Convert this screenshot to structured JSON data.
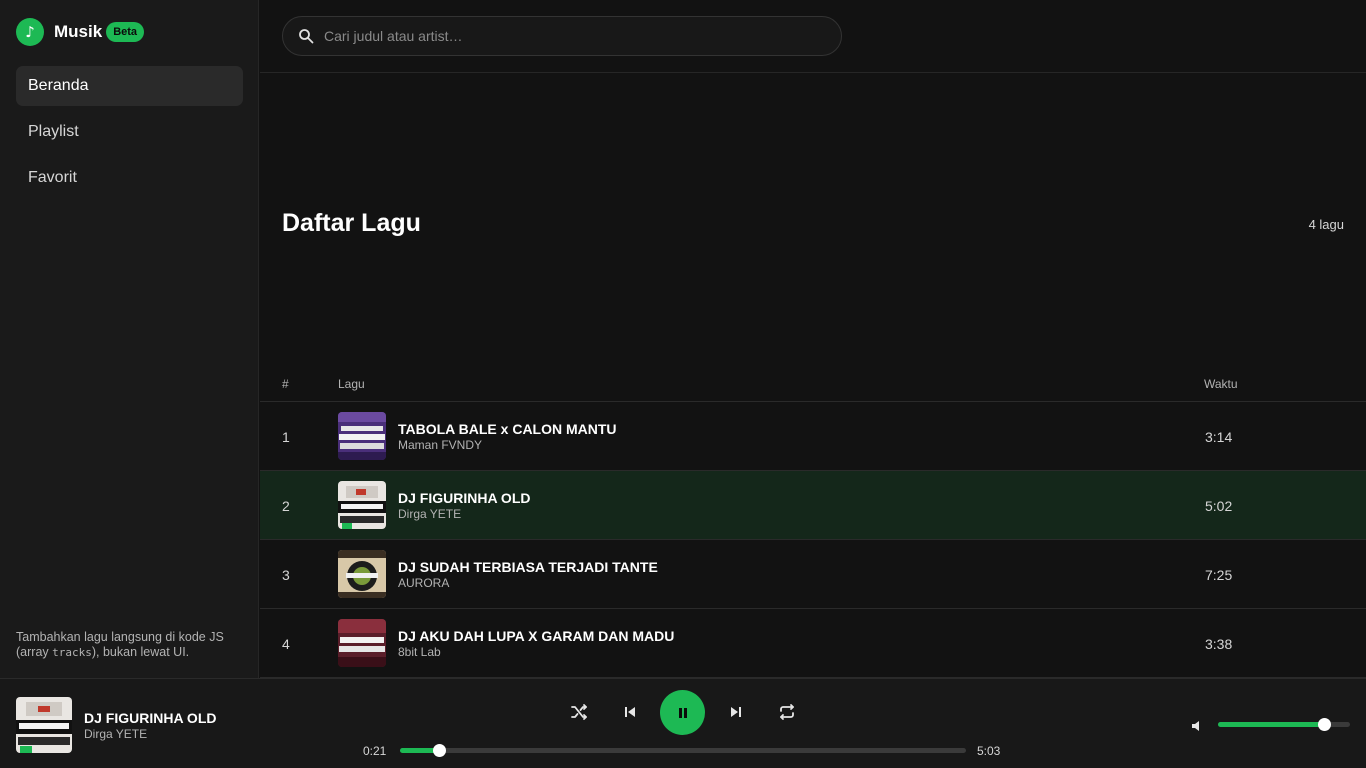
{
  "brand": {
    "name": "Musik",
    "badge": "Beta",
    "logo_icon": "music-note-icon",
    "logo_glyph": "♪"
  },
  "sidebar": {
    "items": [
      {
        "label": "Beranda",
        "active": true
      },
      {
        "label": "Playlist",
        "active": false
      },
      {
        "label": "Favorit",
        "active": false
      }
    ],
    "note_prefix": "Tambahkan lagu langsung di kode JS (array ",
    "note_code": "tracks",
    "note_suffix": "), bukan lewat UI."
  },
  "search": {
    "placeholder": "Cari judul atau artist…",
    "value": "",
    "icon": "search-icon"
  },
  "main": {
    "title": "Daftar Lagu",
    "count": "4 lagu"
  },
  "table": {
    "headers": {
      "num": "#",
      "song": "Lagu",
      "time": "Waktu"
    },
    "tracks": [
      {
        "num": "1",
        "title": "TABOLA BALE x CALON MANTU",
        "artist": "Maman FVNDY",
        "time": "3:14",
        "active": false
      },
      {
        "num": "2",
        "title": "DJ FIGURINHA OLD",
        "artist": "Dirga YETE",
        "time": "5:02",
        "active": true
      },
      {
        "num": "3",
        "title": "DJ SUDAH TERBIASA TERJADI TANTE",
        "artist": "AURORA",
        "time": "7:25",
        "active": false
      },
      {
        "num": "4",
        "title": "DJ AKU DAH LUPA X GARAM DAN MADU",
        "artist": "8bit Lab",
        "time": "3:38",
        "active": false
      }
    ]
  },
  "player": {
    "title": "DJ FIGURINHA OLD",
    "artist": "Dirga YETE",
    "current_time": "0:21",
    "total_time": "5:03",
    "progress": 0.069,
    "volume": 0.8,
    "controls": [
      "shuffle-icon",
      "previous-icon",
      "pause-icon",
      "next-icon",
      "repeat-icon",
      "volume-icon"
    ]
  },
  "colors": {
    "accent": "#1db954",
    "background": "#121212",
    "sidebar": "#1a1a1a",
    "active_row": "#14271a"
  }
}
